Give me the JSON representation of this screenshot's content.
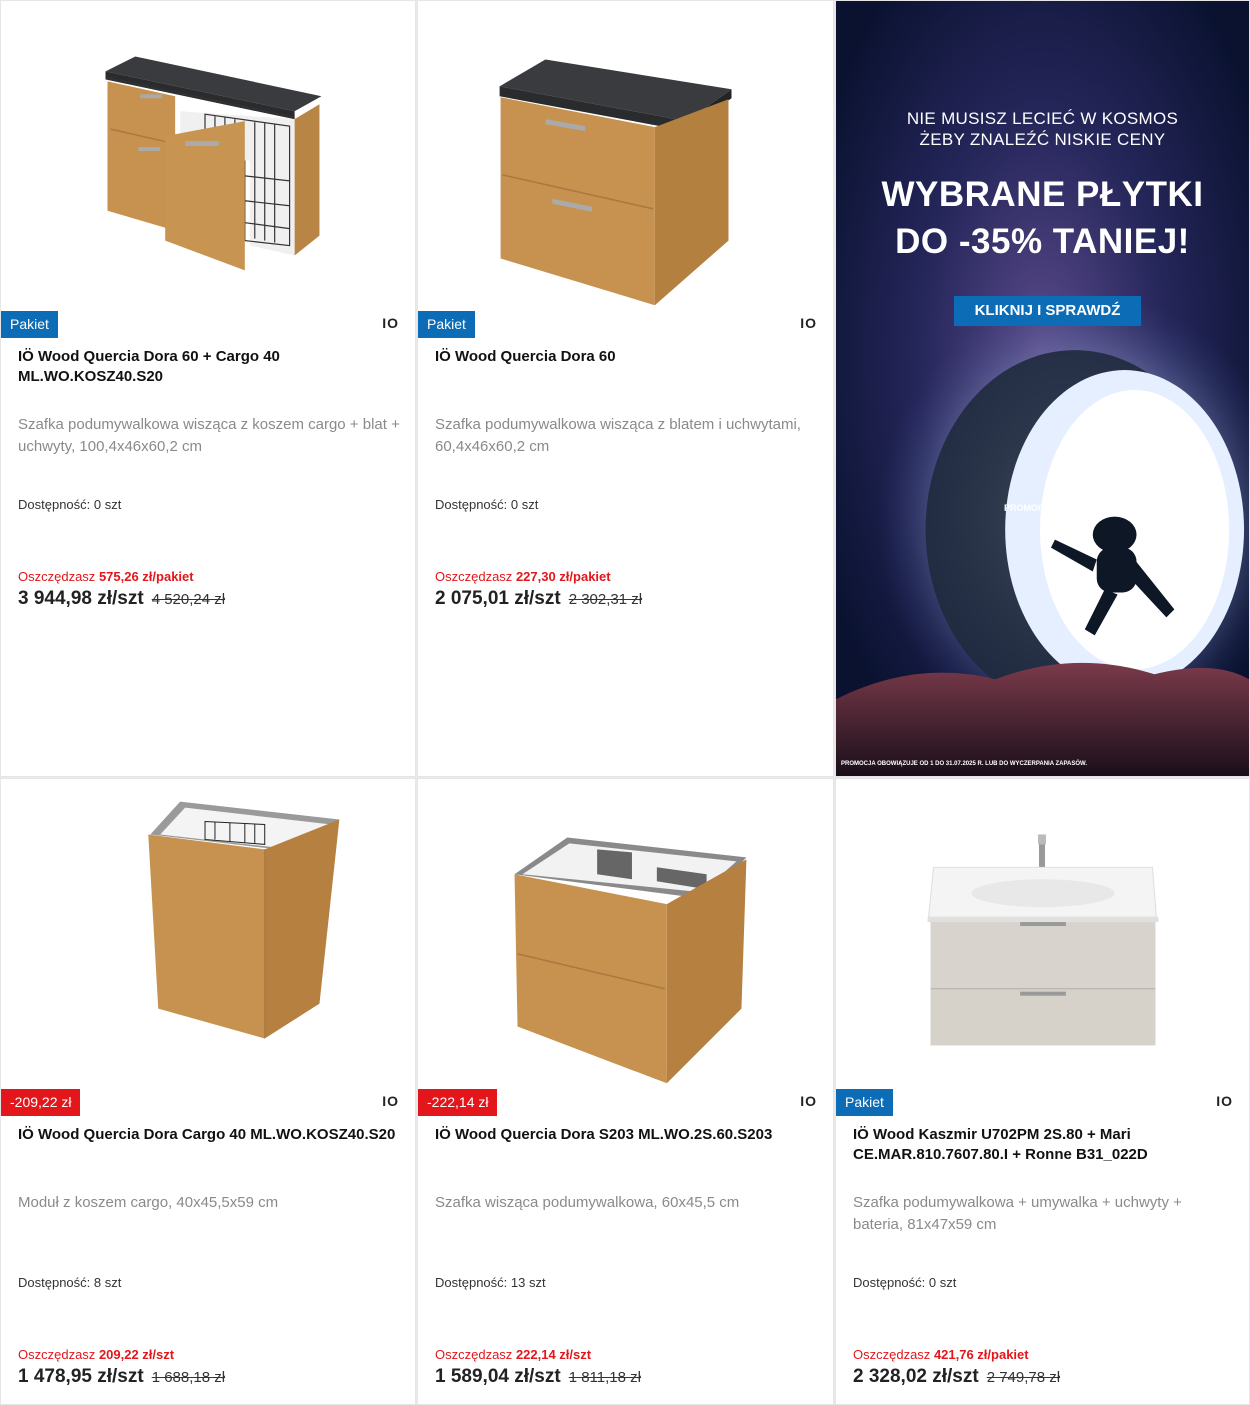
{
  "products": [
    {
      "badge": "Pakiet",
      "brand": "IO",
      "title": "IÖ Wood Quercia Dora 60 + Cargo 40 ML.WO.KOSZ40.S20",
      "description": "Szafka podumywalkowa wisząca z koszem cargo + blat + uchwyty, 100,4x46x60,2 cm",
      "availability_label": "Dostępność:",
      "availability_value": "0 szt",
      "save_label": "Oszczędzasz",
      "save_amount": "575,26 zł/pakiet",
      "price": "3 944,98 zł/szt",
      "old_price": "4 520,24 zł"
    },
    {
      "badge": "Pakiet",
      "brand": "IO",
      "title": "IÖ Wood Quercia Dora 60",
      "description": "Szafka podumywalkowa wisząca z blatem i uchwytami, 60,4x46x60,2 cm",
      "availability_label": "Dostępność:",
      "availability_value": "0 szt",
      "save_label": "Oszczędzasz",
      "save_amount": "227,30 zł/pakiet",
      "price": "2 075,01 zł/szt",
      "old_price": "2 302,31 zł"
    },
    {
      "badge": "-209,22 zł",
      "brand": "IO",
      "title": "IÖ Wood Quercia Dora Cargo 40 ML.WO.KOSZ40.S20",
      "description": "Moduł z koszem cargo, 40x45,5x59 cm",
      "availability_label": "Dostępność:",
      "availability_value": "8 szt",
      "save_label": "Oszczędzasz",
      "save_amount": "209,22 zł/szt",
      "price": "1 478,95 zł/szt",
      "old_price": "1 688,18 zł"
    },
    {
      "badge": "-222,14 zł",
      "brand": "IO",
      "title": "IÖ Wood Quercia Dora S203 ML.WO.2S.60.S203",
      "description": "Szafka wisząca podumywalkowa, 60x45,5 cm",
      "availability_label": "Dostępność:",
      "availability_value": "13 szt",
      "save_label": "Oszczędzasz",
      "save_amount": "222,14 zł/szt",
      "price": "1 589,04 zł/szt",
      "old_price": "1 811,18 zł"
    },
    {
      "badge": "Pakiet",
      "brand": "IO",
      "title": "IÖ Wood Kaszmir U702PM 2S.80 + Mari CE.MAR.810.7607.80.I + Ronne B31_022D",
      "description": "Szafka podumywalkowa + umywalka + uchwyty + bateria, 81x47x59 cm",
      "availability_label": "Dostępność:",
      "availability_value": "0 szt",
      "save_label": "Oszczędzasz",
      "save_amount": "421,76 zł/pakiet",
      "price": "2 328,02 zł/szt",
      "old_price": "2 749,78 zł"
    }
  ],
  "ad": {
    "line1a": "NIE MUSISZ LECIEĆ W KOSMOS",
    "line1b": "ŻEBY ZNALEŹĆ NISKIE CENY",
    "line2a": "WYBRANE PŁYTKI",
    "line2b": "DO -35% TANIEJ!",
    "button": "KLIKNIJ I SPRAWDŹ",
    "tag": "PROMOCJE",
    "footer": "PROMOCJA OBOWIĄZUJE OD 1 DO 31.07.2025 R. LUB DO WYCZERPANIA ZAPASÓW."
  },
  "colors": {
    "pakiet_badge": "#0c6cb5",
    "discount_badge": "#e3161b",
    "save_text": "#e3161b",
    "ad_button": "#0c6cb5"
  }
}
